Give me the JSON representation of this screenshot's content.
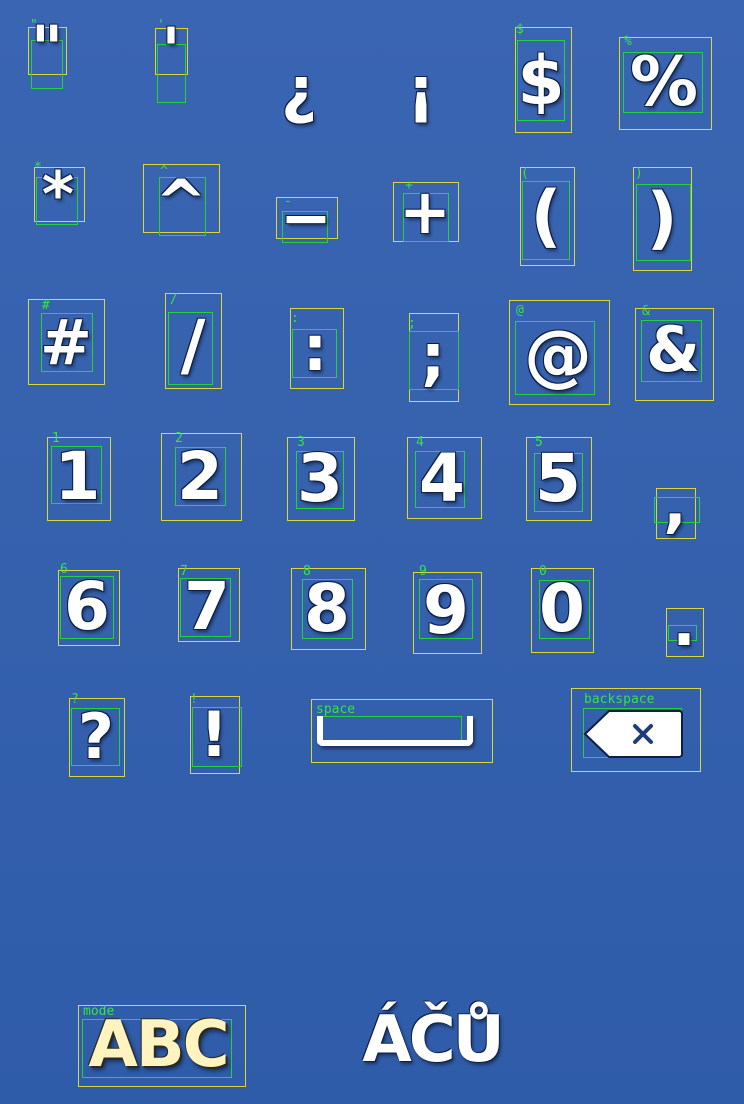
{
  "keys": {
    "dquote": "\"",
    "squote": "'",
    "inv_question": "¿",
    "inv_exclaim": "¡",
    "dollar": "$",
    "percent": "%",
    "asterisk": "*",
    "caret": "^",
    "minus": "−",
    "plus": "+",
    "lparen": "(",
    "rparen": ")",
    "hash": "#",
    "slash": "/",
    "colon": ":",
    "semicolon": ";",
    "at": "@",
    "amp": "&",
    "d1": "1",
    "d2": "2",
    "d3": "3",
    "d4": "4",
    "d5": "5",
    "comma": ",",
    "d6": "6",
    "d7": "7",
    "d8": "8",
    "d9": "9",
    "d0": "0",
    "period": ".",
    "question": "?",
    "exclaim": "!",
    "mode": "ABC",
    "accents": "ÁČŮ"
  },
  "labels": {
    "dquote": "\"",
    "squote": "'",
    "dollar": "$",
    "percent": "%",
    "asterisk": "*",
    "caret": "^",
    "minus": "-",
    "plus": "+",
    "lparen": "(",
    "rparen": ")",
    "hash": "#",
    "slash": "/",
    "colon": ":",
    "semicolon": ";",
    "at": "@",
    "amp": "&",
    "d1": "1",
    "d2": "2",
    "d3": "3",
    "d4": "4",
    "d5": "5",
    "d6": "6",
    "d7": "7",
    "d8": "8",
    "d9": "9",
    "d0": "0",
    "question": "?",
    "exclaim": "!",
    "space": "space",
    "backspace": "backspace",
    "mode": "mode"
  },
  "icons": {
    "space": "space-bar-icon",
    "backspace": "backspace-icon"
  },
  "colors": {
    "background": "#3561ad",
    "key_text": "#ffffff",
    "mode_text": "#fff3bf",
    "outer_box": "#d8d83a",
    "inner_box": "#27d13c"
  }
}
